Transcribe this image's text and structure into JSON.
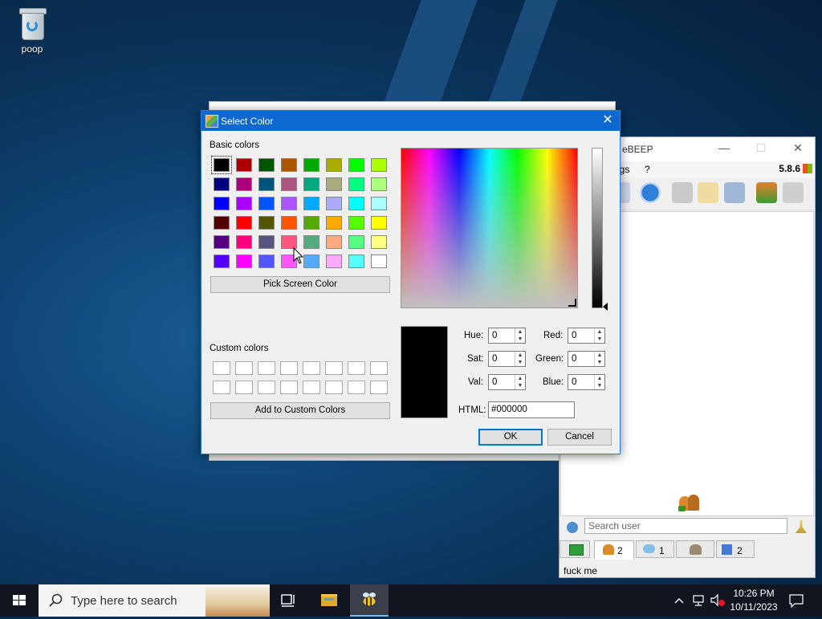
{
  "desktop": {
    "icon_label": "poop"
  },
  "dialog": {
    "title": "Select Color",
    "basic_label": "Basic colors",
    "custom_label": "Custom colors",
    "pick_screen": "Pick Screen Color",
    "add_custom": "Add to Custom Colors",
    "hue_label": "Hue:",
    "sat_label": "Sat:",
    "val_label": "Val:",
    "red_label": "Red:",
    "green_label": "Green:",
    "blue_label": "Blue:",
    "html_label": "HTML:",
    "hue": "0",
    "sat": "0",
    "val": "0",
    "red": "0",
    "green": "0",
    "blue": "0",
    "html": "#000000",
    "ok": "OK",
    "cancel": "Cancel",
    "basic_colors": [
      [
        "#000000",
        "#aa0000",
        "#005500",
        "#aa5500",
        "#00aa00",
        "#aaaa00",
        "#00ff00",
        "#aaff00"
      ],
      [
        "#00007f",
        "#aa007f",
        "#00557f",
        "#aa557f",
        "#00aa7f",
        "#aaaa7f",
        "#00ff7f",
        "#aaff7f"
      ],
      [
        "#0000ff",
        "#aa00ff",
        "#0055ff",
        "#aa55ff",
        "#00aaff",
        "#aaaaff",
        "#00ffff",
        "#aaffff"
      ],
      [
        "#550000",
        "#ff0000",
        "#555500",
        "#ff5500",
        "#55aa00",
        "#ffaa00",
        "#55ff00",
        "#ffff00"
      ],
      [
        "#55007f",
        "#ff007f",
        "#55557f",
        "#ff557f",
        "#55aa7f",
        "#ffaa7f",
        "#55ff7f",
        "#ffff7f"
      ],
      [
        "#5500ff",
        "#ff00ff",
        "#5555ff",
        "#ff55ff",
        "#55aaff",
        "#ffaaff",
        "#55ffff",
        "#ffffff"
      ]
    ]
  },
  "beebeep": {
    "title_fragment": "eBEEP",
    "menu_settings_fragment": "ngs",
    "menu_help": "?",
    "version": "5.8.6",
    "search_placeholder": "Search user",
    "tab_users_count": "2",
    "tab_chats_count": "1",
    "tab_files_count": "2",
    "status_text": "fuck me"
  },
  "taskbar": {
    "search_placeholder": "Type here to search",
    "time": "10:26 PM",
    "date": "10/11/2023"
  }
}
